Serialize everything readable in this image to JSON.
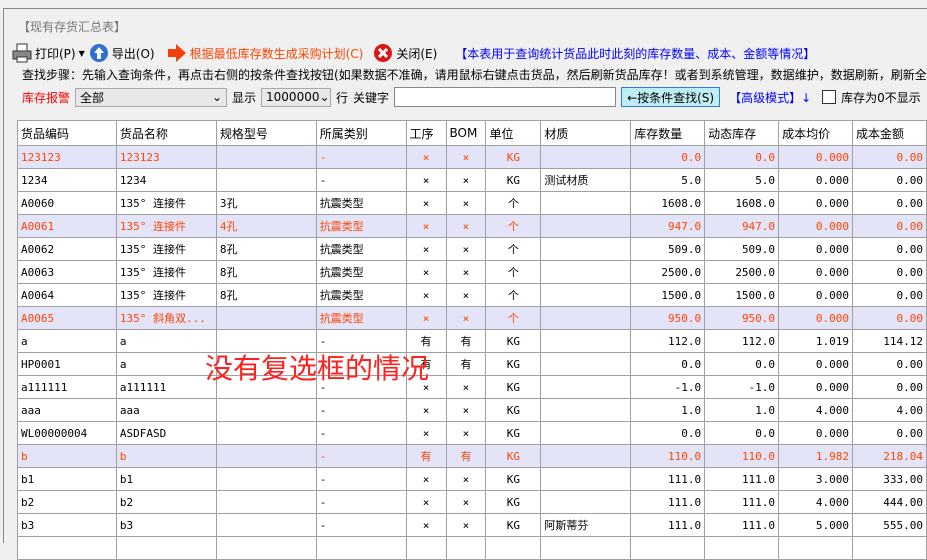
{
  "window": {
    "title": "【现有存货汇总表】"
  },
  "toolbar": {
    "print": "打印(P)",
    "export": "导出(O)",
    "gen_plan": "根据最低库存数生成采购计划(C)",
    "close": "关闭(E)",
    "info": "【本表用于查询统计货品此时此刻的库存数量、成本、金额等情况】"
  },
  "steps": "查找步骤：先输入查询条件，再点击右侧的按条件查找按钮(如果数据不准确，请用鼠标右键点击货品，然后刷新货品库存！或者到系统管理，数据维护，数据刷新，刷新全",
  "filter": {
    "alarm_label": "库存报警",
    "alarm_value": "全部",
    "show_label": "显示",
    "show_value": "1000000",
    "rows_label": "行",
    "keyword_label": "关键字",
    "keyword_value": "",
    "search_button": "←按条件查找(S)",
    "advanced": "【高级模式】↓",
    "hide_zero": "库存为0不显示",
    "hide_zero_checked": false
  },
  "colors": {
    "highlight_bg": "#e4e4f8",
    "highlight_text": "#ff4500",
    "accent_blue": "#0000ff",
    "red": "#ff0000"
  },
  "table": {
    "columns": [
      "货品编码",
      "货品名称",
      "规格型号",
      "所属类别",
      "工序",
      "BOM",
      "单位",
      "材质",
      "库存数量",
      "动态库存",
      "成本均价",
      "成本金额"
    ],
    "rows": [
      {
        "hl": true,
        "cells": [
          "123123",
          "123123",
          "",
          "-",
          "×",
          "×",
          "KG",
          "",
          "0.0",
          "0.0",
          "0.000",
          "0.00"
        ]
      },
      {
        "hl": false,
        "cells": [
          "1234",
          "1234",
          "",
          "-",
          "×",
          "×",
          "KG",
          "测试材质",
          "5.0",
          "5.0",
          "0.000",
          "0.00"
        ]
      },
      {
        "hl": false,
        "cells": [
          "A0060",
          "135° 连接件",
          "3孔",
          "抗震类型",
          "×",
          "×",
          "个",
          "",
          "1608.0",
          "1608.0",
          "0.000",
          "0.00"
        ]
      },
      {
        "hl": true,
        "cells": [
          "A0061",
          "135° 连接件",
          "4孔",
          "抗震类型",
          "×",
          "×",
          "个",
          "",
          "947.0",
          "947.0",
          "0.000",
          "0.00"
        ]
      },
      {
        "hl": false,
        "cells": [
          "A0062",
          "135° 连接件",
          "8孔",
          "抗震类型",
          "×",
          "×",
          "个",
          "",
          "509.0",
          "509.0",
          "0.000",
          "0.00"
        ]
      },
      {
        "hl": false,
        "cells": [
          "A0063",
          "135° 连接件",
          "8孔",
          "抗震类型",
          "×",
          "×",
          "个",
          "",
          "2500.0",
          "2500.0",
          "0.000",
          "0.00"
        ]
      },
      {
        "hl": false,
        "cells": [
          "A0064",
          "135° 连接件",
          "8孔",
          "抗震类型",
          "×",
          "×",
          "个",
          "",
          "1500.0",
          "1500.0",
          "0.000",
          "0.00"
        ]
      },
      {
        "hl": true,
        "cells": [
          "A0065",
          "135° 斜角双...",
          "",
          "抗震类型",
          "×",
          "×",
          "个",
          "",
          "950.0",
          "950.0",
          "0.000",
          "0.00"
        ]
      },
      {
        "hl": false,
        "cells": [
          "a",
          "a",
          "",
          "-",
          "有",
          "有",
          "KG",
          "",
          "112.0",
          "112.0",
          "1.019",
          "114.12"
        ]
      },
      {
        "hl": false,
        "cells": [
          "HP0001",
          "a",
          "",
          "-",
          "有",
          "有",
          "KG",
          "",
          "0.0",
          "0.0",
          "0.000",
          "0.00"
        ]
      },
      {
        "hl": false,
        "cells": [
          "a111111",
          "a111111",
          "",
          "-",
          "×",
          "×",
          "KG",
          "",
          "-1.0",
          "-1.0",
          "0.000",
          "0.00"
        ]
      },
      {
        "hl": false,
        "cells": [
          "aaa",
          "aaa",
          "",
          "-",
          "×",
          "×",
          "KG",
          "",
          "1.0",
          "1.0",
          "4.000",
          "4.00"
        ]
      },
      {
        "hl": false,
        "cells": [
          "WL00000004",
          "ASDFASD",
          "",
          "-",
          "×",
          "×",
          "KG",
          "",
          "0.0",
          "0.0",
          "0.000",
          "0.00"
        ]
      },
      {
        "hl": true,
        "cells": [
          "b",
          "b",
          "",
          "-",
          "有",
          "有",
          "KG",
          "",
          "110.0",
          "110.0",
          "1.982",
          "218.04"
        ]
      },
      {
        "hl": false,
        "cells": [
          "b1",
          "b1",
          "",
          "-",
          "×",
          "×",
          "KG",
          "",
          "111.0",
          "111.0",
          "3.000",
          "333.00"
        ]
      },
      {
        "hl": false,
        "cells": [
          "b2",
          "b2",
          "",
          "-",
          "×",
          "×",
          "KG",
          "",
          "111.0",
          "111.0",
          "4.000",
          "444.00"
        ]
      },
      {
        "hl": false,
        "cells": [
          "b3",
          "b3",
          "",
          "-",
          "×",
          "×",
          "KG",
          "阿斯蒂芬",
          "111.0",
          "111.0",
          "5.000",
          "555.00"
        ]
      },
      {
        "hl": false,
        "cells": [
          "",
          "",
          "",
          "",
          "",
          "",
          "",
          "",
          "",
          "",
          "",
          ""
        ]
      }
    ]
  },
  "overlay_text": "没有复选框的情况"
}
